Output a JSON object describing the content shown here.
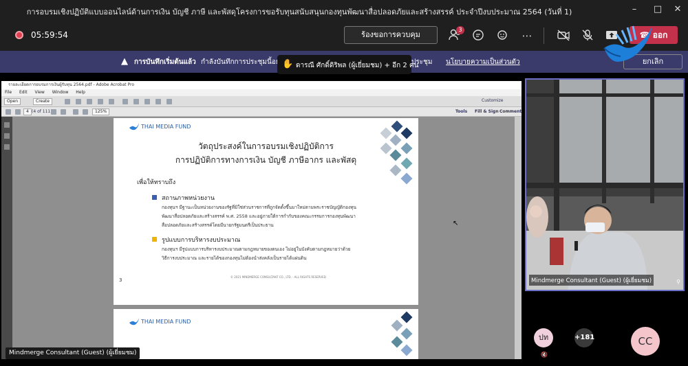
{
  "window": {
    "title": "การอบรมเชิงปฏิบัติแบบออนไลน์ด้านการเงิน บัญชี ภาษี และพัสดุโครงการขอรับทุนสนับสนุนกองทุนพัฒนาสื่อปลอดภัยและสร้างสรรค์ ประจำปีงบประมาณ 2564 (วันที่ 1)"
  },
  "toolbar": {
    "timer": "05:59:54",
    "request_control_label": "ร้องขอการควบคุม",
    "participants_badge": "3",
    "leave_label": "ออก",
    "leave_color": "#c4314b"
  },
  "banner": {
    "recording_started": "การบันทึกเริ่มต้นแล้ว",
    "recording_notice": "กำลังบันทึกการประชุมนี้อยู่ แจ้ง",
    "meeting_word": "ประชุม",
    "privacy_link": "นโยบายความเป็นส่วนตัว",
    "cancel_label": "ยกเลิก",
    "bg_color": "#3b3b6b"
  },
  "raise_hand": {
    "text": "ดารณี ศักดิ์ดิริพล (ผู้เยี่ยมชม) + อีก 2 คน",
    "color": "#f5b400"
  },
  "acrobat": {
    "title": "รายละเอียดการอบรมการเงินผู้รับทุน 2564.pdf - Adobe Acrobat Pro",
    "menu": [
      "File",
      "Edit",
      "View",
      "Window",
      "Help"
    ],
    "open_label": "Open",
    "create_label": "Create",
    "customize_label": "Customize",
    "page_value": "4",
    "page_count": "(4 of 111)",
    "zoom_value": "125%",
    "tools_label": "Tools",
    "fill_sign_label": "Fill & Sign",
    "comment_label": "Comment"
  },
  "pdf_page": {
    "logo_text": "THAI MEDIA FUND",
    "title_line1": "วัตถุประสงค์ในการอบรมเชิงปฏิบัติการ",
    "title_line2": "การปฏิบัติการทางการเงิน บัญชี ภาษีอากร และพัสดุ",
    "subtitle": "เพื่อให้ทราบถึง",
    "section1_heading": "สถานภาพหน่วยงาน",
    "section1_line1": "กองทุนฯ มีฐานะเป็นหน่วยงานของรัฐที่มิใช่ส่วนราชการที่ถูกจัดตั้งขึ้นมาใหม่ตามพระราชบัญญัติกองทุน",
    "section1_line2": "พัฒนาสื่อปลอดภัยและสร้างสรรค์ พ.ศ. 2558 และอยู่ภายใต้การกำกับของคณะกรรมการกองทุนพัฒนา",
    "section1_line3": "สื่อปลอดภัยและสร้างสรรค์โดยมีนายกรัฐมนตรีเป็นประธาน",
    "section1_color": "#3a5fb0",
    "section2_heading": "รูปแบบการบริหารงบประมาณ",
    "section2_line1": "กองทุนฯ มีรูปแบบการบริหารงบประมาณตามกฎหมายของตนเอง ไม่อยู่ในบังคับตามกฎหมายว่าด้วย",
    "section2_line2": "วิธีการงบประมาณ และรายได้ของกองทุนไม่ต้องนำส่งคลังเป็นรายได้แผ่นดิน",
    "section2_color": "#f0b400",
    "page_number": "3",
    "footer": "© 2021 MINDMERGE CONSULTANT CO., LTD. · ALL RIGHTS RESERVED"
  },
  "page2": {
    "logo_text": "THAI MEDIA FUND"
  },
  "presenter": {
    "name_tag": "Mindmerge Consultant (Guest) (ผู้เยี่ยมชม)"
  },
  "video_tile": {
    "name": "Mindmerge Consultant (Guest) (ผู้เยี่ยมชม)",
    "border_color": "#6b6fc8"
  },
  "participants": {
    "avatar1": "ปท",
    "more_count": "+181",
    "avatar3": "CC"
  }
}
